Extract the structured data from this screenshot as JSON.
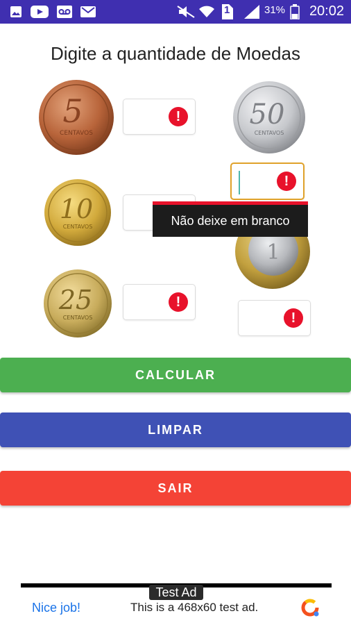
{
  "status_bar": {
    "battery_percent": "31%",
    "clock": "20:02",
    "sim_number": "1",
    "icons": [
      "image-icon",
      "youtube-icon",
      "voicemail-icon",
      "mail-icon",
      "mute-icon",
      "wifi-icon",
      "sim-icon",
      "signal-icon",
      "battery-icon"
    ]
  },
  "title": "Digite a quantidade de Moedas",
  "coins": [
    {
      "name": "coin-5-centavos",
      "numeral": "5",
      "caption": "CENTAVOS",
      "metal": "copper"
    },
    {
      "name": "coin-10-centavos",
      "numeral": "10",
      "caption": "CENTAVOS",
      "metal": "gold"
    },
    {
      "name": "coin-25-centavos",
      "numeral": "25",
      "caption": "CENTAVOS",
      "metal": "gold"
    },
    {
      "name": "coin-50-centavos",
      "numeral": "50",
      "caption": "CENTAVOS",
      "metal": "silver"
    },
    {
      "name": "coin-1-real",
      "numeral": "1",
      "caption": "",
      "metal": "bimetal"
    }
  ],
  "fields": [
    {
      "value": "",
      "error": true
    },
    {
      "value": "",
      "error": true
    },
    {
      "value": "",
      "error": true
    },
    {
      "value": "",
      "error": true,
      "focused": true
    },
    {
      "value": "",
      "error": true
    }
  ],
  "error_glyph": "!",
  "tooltip": "Não deixe em branco",
  "buttons": {
    "calcular": {
      "label": "CALCULAR",
      "color": "#4caf50"
    },
    "limpar": {
      "label": "LIMPAR",
      "color": "#3f51b5"
    },
    "sair": {
      "label": "SAIR",
      "color": "#f44336"
    }
  },
  "ad": {
    "badge": "Test Ad",
    "nice": "Nice job!",
    "text": "This is a 468x60 test ad."
  },
  "colors": {
    "status_bar": "#3f2fb0",
    "error": "#e8122b",
    "focus_border": "#e0a22a"
  }
}
